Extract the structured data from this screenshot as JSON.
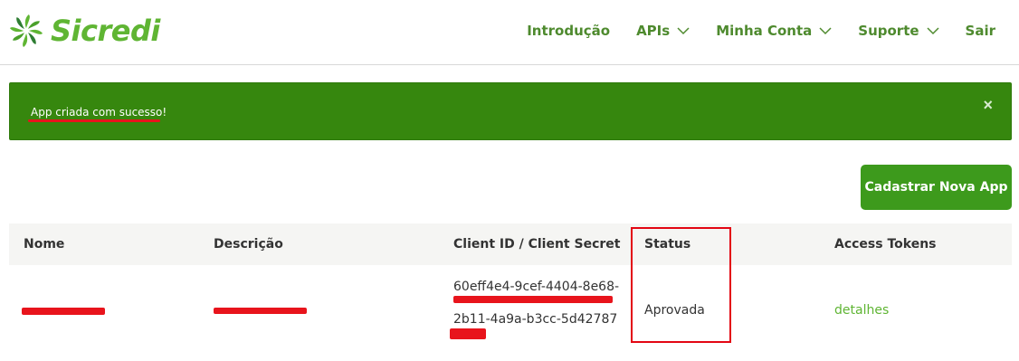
{
  "brand": {
    "name": "Sicredi",
    "color": "#5fb533"
  },
  "nav": [
    {
      "label": "Introdução",
      "dropdown": false
    },
    {
      "label": "APIs",
      "dropdown": true
    },
    {
      "label": "Minha Conta",
      "dropdown": true
    },
    {
      "label": "Suporte",
      "dropdown": true
    },
    {
      "label": "Sair",
      "dropdown": false
    }
  ],
  "alert": {
    "message": "App criada com sucesso!",
    "close_symbol": "×",
    "color": "#36870e"
  },
  "actions": {
    "new_app_label": "Cadastrar Nova App"
  },
  "table": {
    "headers": [
      "Nome",
      "Descrição",
      "Client ID / Client Secret",
      "Status",
      "Access Tokens"
    ],
    "rows": [
      {
        "client_id_line1": "60eff4e4-9cef-4404-8e68-",
        "client_id_line2": "2b11-4a9a-b3cc-5d42787",
        "status": "Aprovada",
        "tokens_link": "detalhes"
      }
    ]
  },
  "annotation_color": "#e30613"
}
